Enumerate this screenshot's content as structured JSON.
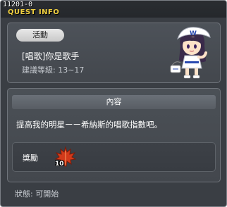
{
  "window": {
    "id": "11201-0",
    "title": "QUEST INFO"
  },
  "quest": {
    "category": "活動",
    "name": "[唱歌]你是歌手",
    "recommended_level": "建議等級: 13~17"
  },
  "content": {
    "header": "內容",
    "description": "提高我的明星ーー希納斯的唱歌指數吧。"
  },
  "reward": {
    "label": "獎勵",
    "item_icon": "maple-leaf-icon",
    "quantity": "10"
  },
  "status": "狀態: 可開始",
  "colors": {
    "window_bg": "#3a3e44",
    "title_yellow": "#f0d040",
    "leaf_red": "#d23a1a",
    "panel_border": "#6f747b"
  }
}
